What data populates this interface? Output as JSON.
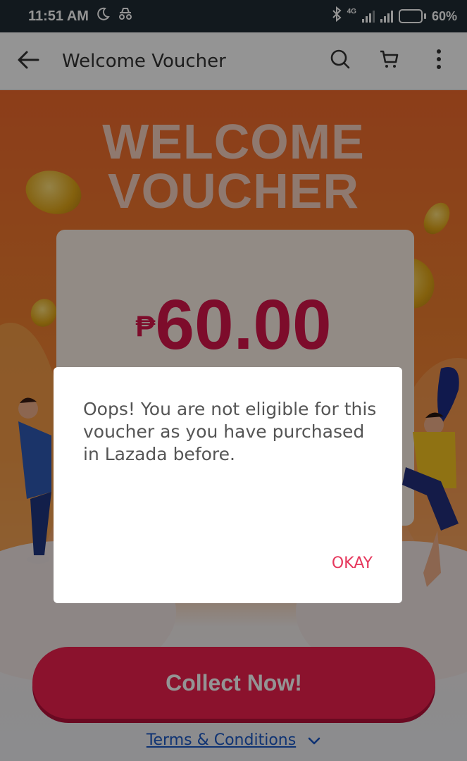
{
  "status_bar": {
    "time": "11:51 AM",
    "network": "4G",
    "battery_percent": "60%",
    "battery_level": 0.6,
    "icons": [
      "moon-icon",
      "incognito-icon",
      "bluetooth-icon",
      "signal-icon",
      "battery-icon"
    ]
  },
  "app_bar": {
    "title": "Welcome Voucher",
    "icons": [
      "back-arrow-icon",
      "search-icon",
      "cart-icon",
      "more-vertical-icon"
    ]
  },
  "hero": {
    "title_line1": "WELCOME",
    "title_line2": "VOUCHER"
  },
  "voucher": {
    "currency": "₱",
    "amount": "60.00"
  },
  "collect_button": {
    "label": "Collect Now!"
  },
  "terms": {
    "label": "Terms & Conditions"
  },
  "dialog": {
    "message": "Oops! You are not eligible for this voucher as you have purchased in Lazada before.",
    "ok_label": "OKAY"
  },
  "colors": {
    "status_bar": "#1f2b35",
    "accent_red": "#e6385d",
    "button_red": "#f0204e",
    "amount_red": "#d7154a",
    "link_blue": "#1a58c6",
    "hero_orange": "#f26a2c"
  }
}
